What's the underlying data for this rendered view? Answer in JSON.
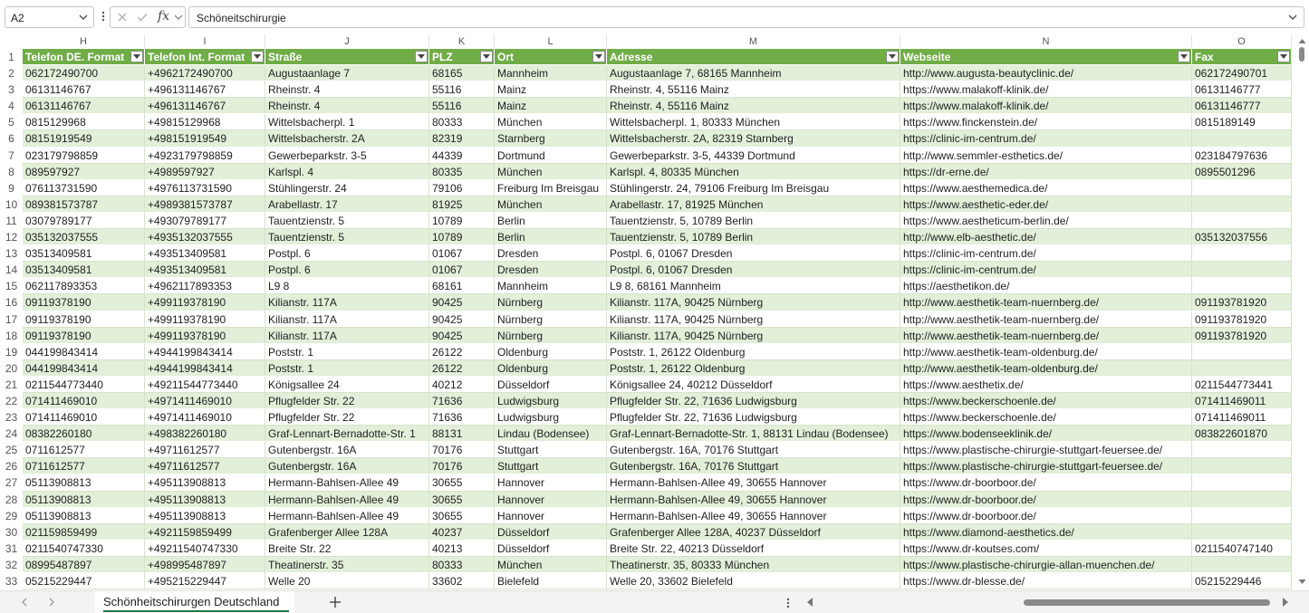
{
  "formula_bar": {
    "name_box": "A2",
    "fx_label": "fx",
    "formula": "Schöneitschirurgie"
  },
  "columns": [
    {
      "letter": "H",
      "header": "Telefon DE. Format"
    },
    {
      "letter": "I",
      "header": "Telefon Int. Format"
    },
    {
      "letter": "J",
      "header": "Straße"
    },
    {
      "letter": "K",
      "header": "PLZ"
    },
    {
      "letter": "L",
      "header": "Ort"
    },
    {
      "letter": "M",
      "header": "Adresse"
    },
    {
      "letter": "N",
      "header": "Webseite"
    },
    {
      "letter": "O",
      "header": "Fax"
    }
  ],
  "rows": [
    {
      "n": "2",
      "cells": [
        "062172490700",
        "+4962172490700",
        "Augustaanlage 7",
        "68165",
        "Mannheim",
        "Augustaanlage 7, 68165 Mannheim",
        "http://www.augusta-beautyclinic.de/",
        "062172490701"
      ]
    },
    {
      "n": "3",
      "cells": [
        "06131146767",
        "+496131146767",
        "Rheinstr. 4",
        "55116",
        "Mainz",
        "Rheinstr. 4, 55116 Mainz",
        "https://www.malakoff-klinik.de/",
        "06131146777"
      ]
    },
    {
      "n": "4",
      "cells": [
        "06131146767",
        "+496131146767",
        "Rheinstr. 4",
        "55116",
        "Mainz",
        "Rheinstr. 4, 55116 Mainz",
        "https://www.malakoff-klinik.de/",
        "06131146777"
      ]
    },
    {
      "n": "5",
      "cells": [
        "0815129968",
        "+49815129968",
        "Wittelsbacherpl. 1",
        "80333",
        "München",
        "Wittelsbacherpl. 1, 80333 München",
        "https://www.finckenstein.de/",
        "0815189149"
      ]
    },
    {
      "n": "6",
      "cells": [
        "08151919549",
        "+498151919549",
        "Wittelsbacherstr. 2A",
        "82319",
        "Starnberg",
        "Wittelsbacherstr. 2A, 82319 Starnberg",
        "https://clinic-im-centrum.de/",
        ""
      ]
    },
    {
      "n": "7",
      "cells": [
        "023179798859",
        "+4923179798859",
        "Gewerbeparkstr. 3-5",
        "44339",
        "Dortmund",
        "Gewerbeparkstr. 3-5, 44339 Dortmund",
        "http://www.semmler-esthetics.de/",
        "023184797636"
      ]
    },
    {
      "n": "8",
      "cells": [
        "089597927",
        "+4989597927",
        "Karlspl. 4",
        "80335",
        "München",
        "Karlspl. 4, 80335 München",
        "https://dr-erne.de/",
        "0895501296"
      ]
    },
    {
      "n": "9",
      "cells": [
        "076113731590",
        "+4976113731590",
        "Stühlingerstr. 24",
        "79106",
        "Freiburg Im Breisgau",
        "Stühlingerstr. 24, 79106 Freiburg Im Breisgau",
        "https://www.aesthemedica.de/",
        ""
      ]
    },
    {
      "n": "10",
      "cells": [
        "089381573787",
        "+4989381573787",
        "Arabellastr. 17",
        "81925",
        "München",
        "Arabellastr. 17, 81925 München",
        "https://www.aesthetic-eder.de/",
        ""
      ]
    },
    {
      "n": "11",
      "cells": [
        "03079789177",
        "+493079789177",
        "Tauentzienstr. 5",
        "10789",
        "Berlin",
        "Tauentzienstr. 5, 10789 Berlin",
        "https://www.aestheticum-berlin.de/",
        ""
      ]
    },
    {
      "n": "12",
      "cells": [
        "035132037555",
        "+4935132037555",
        "Tauentzienstr. 5",
        "10789",
        "Berlin",
        "Tauentzienstr. 5, 10789 Berlin",
        "http://www.elb-aesthetic.de/",
        "035132037556"
      ]
    },
    {
      "n": "13",
      "cells": [
        "03513409581",
        "+493513409581",
        "Postpl. 6",
        "01067",
        "Dresden",
        "Postpl. 6, 01067 Dresden",
        "https://clinic-im-centrum.de/",
        ""
      ]
    },
    {
      "n": "14",
      "cells": [
        "03513409581",
        "+493513409581",
        "Postpl. 6",
        "01067",
        "Dresden",
        "Postpl. 6, 01067 Dresden",
        "https://clinic-im-centrum.de/",
        ""
      ]
    },
    {
      "n": "15",
      "cells": [
        "062117893353",
        "+4962117893353",
        "L9 8",
        "68161",
        "Mannheim",
        "L9 8, 68161 Mannheim",
        "https://aesthetikon.de/",
        ""
      ]
    },
    {
      "n": "16",
      "cells": [
        "09119378190",
        "+499119378190",
        "Kilianstr. 117A",
        "90425",
        "Nürnberg",
        "Kilianstr. 117A, 90425 Nürnberg",
        "http://www.aesthetik-team-nuernberg.de/",
        "091193781920"
      ]
    },
    {
      "n": "17",
      "cells": [
        "09119378190",
        "+499119378190",
        "Kilianstr. 117A",
        "90425",
        "Nürnberg",
        "Kilianstr. 117A, 90425 Nürnberg",
        "http://www.aesthetik-team-nuernberg.de/",
        "091193781920"
      ]
    },
    {
      "n": "18",
      "cells": [
        "09119378190",
        "+499119378190",
        "Kilianstr. 117A",
        "90425",
        "Nürnberg",
        "Kilianstr. 117A, 90425 Nürnberg",
        "http://www.aesthetik-team-nuernberg.de/",
        "091193781920"
      ]
    },
    {
      "n": "19",
      "cells": [
        "044199843414",
        "+4944199843414",
        "Poststr. 1",
        "26122",
        "Oldenburg",
        "Poststr. 1, 26122 Oldenburg",
        "http://www.aesthetik-team-oldenburg.de/",
        ""
      ]
    },
    {
      "n": "20",
      "cells": [
        "044199843414",
        "+4944199843414",
        "Poststr. 1",
        "26122",
        "Oldenburg",
        "Poststr. 1, 26122 Oldenburg",
        "http://www.aesthetik-team-oldenburg.de/",
        ""
      ]
    },
    {
      "n": "21",
      "cells": [
        "0211544773440",
        "+49211544773440",
        "Königsallee 24",
        "40212",
        "Düsseldorf",
        "Königsallee 24, 40212 Düsseldorf",
        "https://www.aesthetix.de/",
        "0211544773441"
      ]
    },
    {
      "n": "22",
      "cells": [
        "071411469010",
        "+4971411469010",
        "Pflugfelder Str. 22",
        "71636",
        "Ludwigsburg",
        "Pflugfelder Str. 22, 71636 Ludwigsburg",
        "https://www.beckerschoenle.de/",
        "071411469011"
      ]
    },
    {
      "n": "23",
      "cells": [
        "071411469010",
        "+4971411469010",
        "Pflugfelder Str. 22",
        "71636",
        "Ludwigsburg",
        "Pflugfelder Str. 22, 71636 Ludwigsburg",
        "https://www.beckerschoenle.de/",
        "071411469011"
      ]
    },
    {
      "n": "24",
      "cells": [
        "08382260180",
        "+498382260180",
        "Graf-Lennart-Bernadotte-Str. 1",
        "88131",
        "Lindau (Bodensee)",
        "Graf-Lennart-Bernadotte-Str. 1, 88131 Lindau (Bodensee)",
        "https://www.bodenseeklinik.de/",
        "083822601870"
      ]
    },
    {
      "n": "25",
      "cells": [
        "0711612577",
        "+49711612577",
        "Gutenbergstr. 16A",
        "70176",
        "Stuttgart",
        "Gutenbergstr. 16A, 70176 Stuttgart",
        "https://www.plastische-chirurgie-stuttgart-feuersee.de/",
        ""
      ]
    },
    {
      "n": "26",
      "cells": [
        "0711612577",
        "+49711612577",
        "Gutenbergstr. 16A",
        "70176",
        "Stuttgart",
        "Gutenbergstr. 16A, 70176 Stuttgart",
        "https://www.plastische-chirurgie-stuttgart-feuersee.de/",
        ""
      ]
    },
    {
      "n": "27",
      "cells": [
        "05113908813",
        "+495113908813",
        "Hermann-Bahlsen-Allee 49",
        "30655",
        "Hannover",
        "Hermann-Bahlsen-Allee 49, 30655 Hannover",
        "https://www.dr-boorboor.de/",
        ""
      ]
    },
    {
      "n": "28",
      "cells": [
        "05113908813",
        "+495113908813",
        "Hermann-Bahlsen-Allee 49",
        "30655",
        "Hannover",
        "Hermann-Bahlsen-Allee 49, 30655 Hannover",
        "https://www.dr-boorboor.de/",
        ""
      ]
    },
    {
      "n": "29",
      "cells": [
        "05113908813",
        "+495113908813",
        "Hermann-Bahlsen-Allee 49",
        "30655",
        "Hannover",
        "Hermann-Bahlsen-Allee 49, 30655 Hannover",
        "https://www.dr-boorboor.de/",
        ""
      ]
    },
    {
      "n": "30",
      "cells": [
        "021159859499",
        "+4921159859499",
        "Grafenberger Allee 128A",
        "40237",
        "Düsseldorf",
        "Grafenberger Allee 128A, 40237 Düsseldorf",
        "https://www.diamond-aesthetics.de/",
        ""
      ]
    },
    {
      "n": "31",
      "cells": [
        "0211540747330",
        "+49211540747330",
        "Breite Str. 22",
        "40213",
        "Düsseldorf",
        "Breite Str. 22, 40213 Düsseldorf",
        "https://www.dr-koutses.com/",
        "0211540747140"
      ]
    },
    {
      "n": "32",
      "cells": [
        "08995487897",
        "+498995487897",
        "Theatinerstr. 35",
        "80333",
        "München",
        "Theatinerstr. 35, 80333 München",
        "https://www.plastische-chirurgie-allan-muenchen.de/",
        ""
      ]
    },
    {
      "n": "33",
      "cells": [
        "05215229447",
        "+495215229447",
        "Welle 20",
        "33602",
        "Bielefeld",
        "Welle 20, 33602 Bielefeld",
        "https://www.dr-blesse.de/",
        "05215229446"
      ]
    }
  ],
  "header_row_number": "1",
  "sheet_tab": "Schönheitschirurgen Deutschland",
  "colors": {
    "header_green": "#70ad47",
    "band_green": "#e2efd9",
    "accent": "#217346"
  },
  "icons": {
    "name_box_dropdown": "chevron-down-icon",
    "cancel": "x-icon",
    "enter": "check-icon",
    "function": "fx-icon",
    "filter": "filter-dropdown-icon",
    "add_sheet": "plus-icon"
  }
}
